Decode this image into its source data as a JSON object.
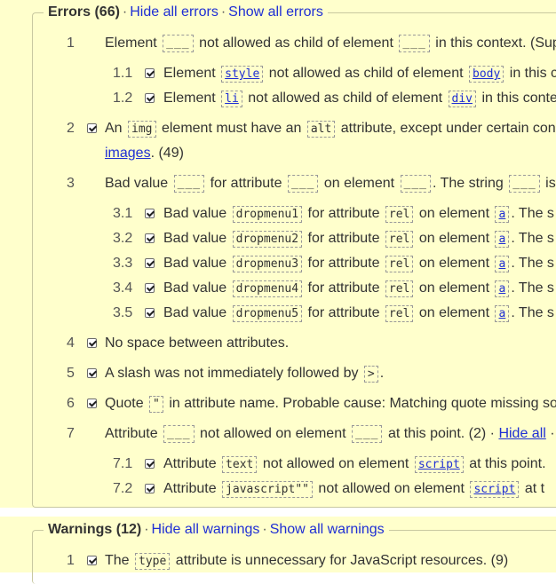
{
  "errors": {
    "title": "Errors (66)",
    "hide_all": "Hide all errors",
    "show_all": "Show all errors",
    "sep": "·",
    "items": [
      {
        "num": "1",
        "parts": [
          "Element",
          "not allowed as child of element",
          "in this context. (Sup"
        ]
      },
      {
        "num": "1.1",
        "parts": [
          "Element",
          "style",
          "not allowed as child of element",
          "body",
          "in this c"
        ]
      },
      {
        "num": "1.2",
        "parts": [
          "Element",
          "li",
          "not allowed as child of element",
          "div",
          "in this conte"
        ]
      },
      {
        "num": "2",
        "parts": [
          "An",
          "img",
          "element must have an",
          "alt",
          "attribute, except under certain con"
        ],
        "line2": "images",
        "line2_suffix": ". (49)"
      },
      {
        "num": "3",
        "parts": [
          "Bad value",
          "for attribute",
          "on element",
          ". The string",
          "is n"
        ]
      },
      {
        "num": "3.1",
        "parts": [
          "Bad value",
          "dropmenu1",
          "for attribute",
          "rel",
          "on element",
          "a",
          ". The s"
        ]
      },
      {
        "num": "3.2",
        "parts": [
          "Bad value",
          "dropmenu2",
          "for attribute",
          "rel",
          "on element",
          "a",
          ". The s"
        ]
      },
      {
        "num": "3.3",
        "parts": [
          "Bad value",
          "dropmenu3",
          "for attribute",
          "rel",
          "on element",
          "a",
          ". The s"
        ]
      },
      {
        "num": "3.4",
        "parts": [
          "Bad value",
          "dropmenu4",
          "for attribute",
          "rel",
          "on element",
          "a",
          ". The s"
        ]
      },
      {
        "num": "3.5",
        "parts": [
          "Bad value",
          "dropmenu5",
          "for attribute",
          "rel",
          "on element",
          "a",
          ". The s"
        ]
      },
      {
        "num": "4",
        "parts": [
          "No space between attributes."
        ]
      },
      {
        "num": "5",
        "parts": [
          "A slash was not immediately followed by",
          ">",
          "."
        ]
      },
      {
        "num": "6",
        "parts": [
          "Quote",
          "\"",
          "in attribute name. Probable cause: Matching quote missing so"
        ]
      },
      {
        "num": "7",
        "parts": [
          "Attribute",
          "not allowed on element",
          "at this point. (2) ·",
          "Hide all",
          "·"
        ]
      },
      {
        "num": "7.1",
        "parts": [
          "Attribute",
          "text",
          "not allowed on element",
          "script",
          "at this point."
        ]
      },
      {
        "num": "7.2",
        "parts": [
          "Attribute",
          "javascript\"\"",
          "not allowed on element",
          "script",
          "at t"
        ]
      }
    ]
  },
  "warnings": {
    "title": "Warnings (12)",
    "hide_all": "Hide all warnings",
    "show_all": "Show all warnings",
    "sep": "·",
    "items": [
      {
        "num": "1",
        "parts": [
          "The",
          "type",
          "attribute is unnecessary for JavaScript resources. (9)"
        ]
      }
    ]
  },
  "blank_placeholder": "___"
}
